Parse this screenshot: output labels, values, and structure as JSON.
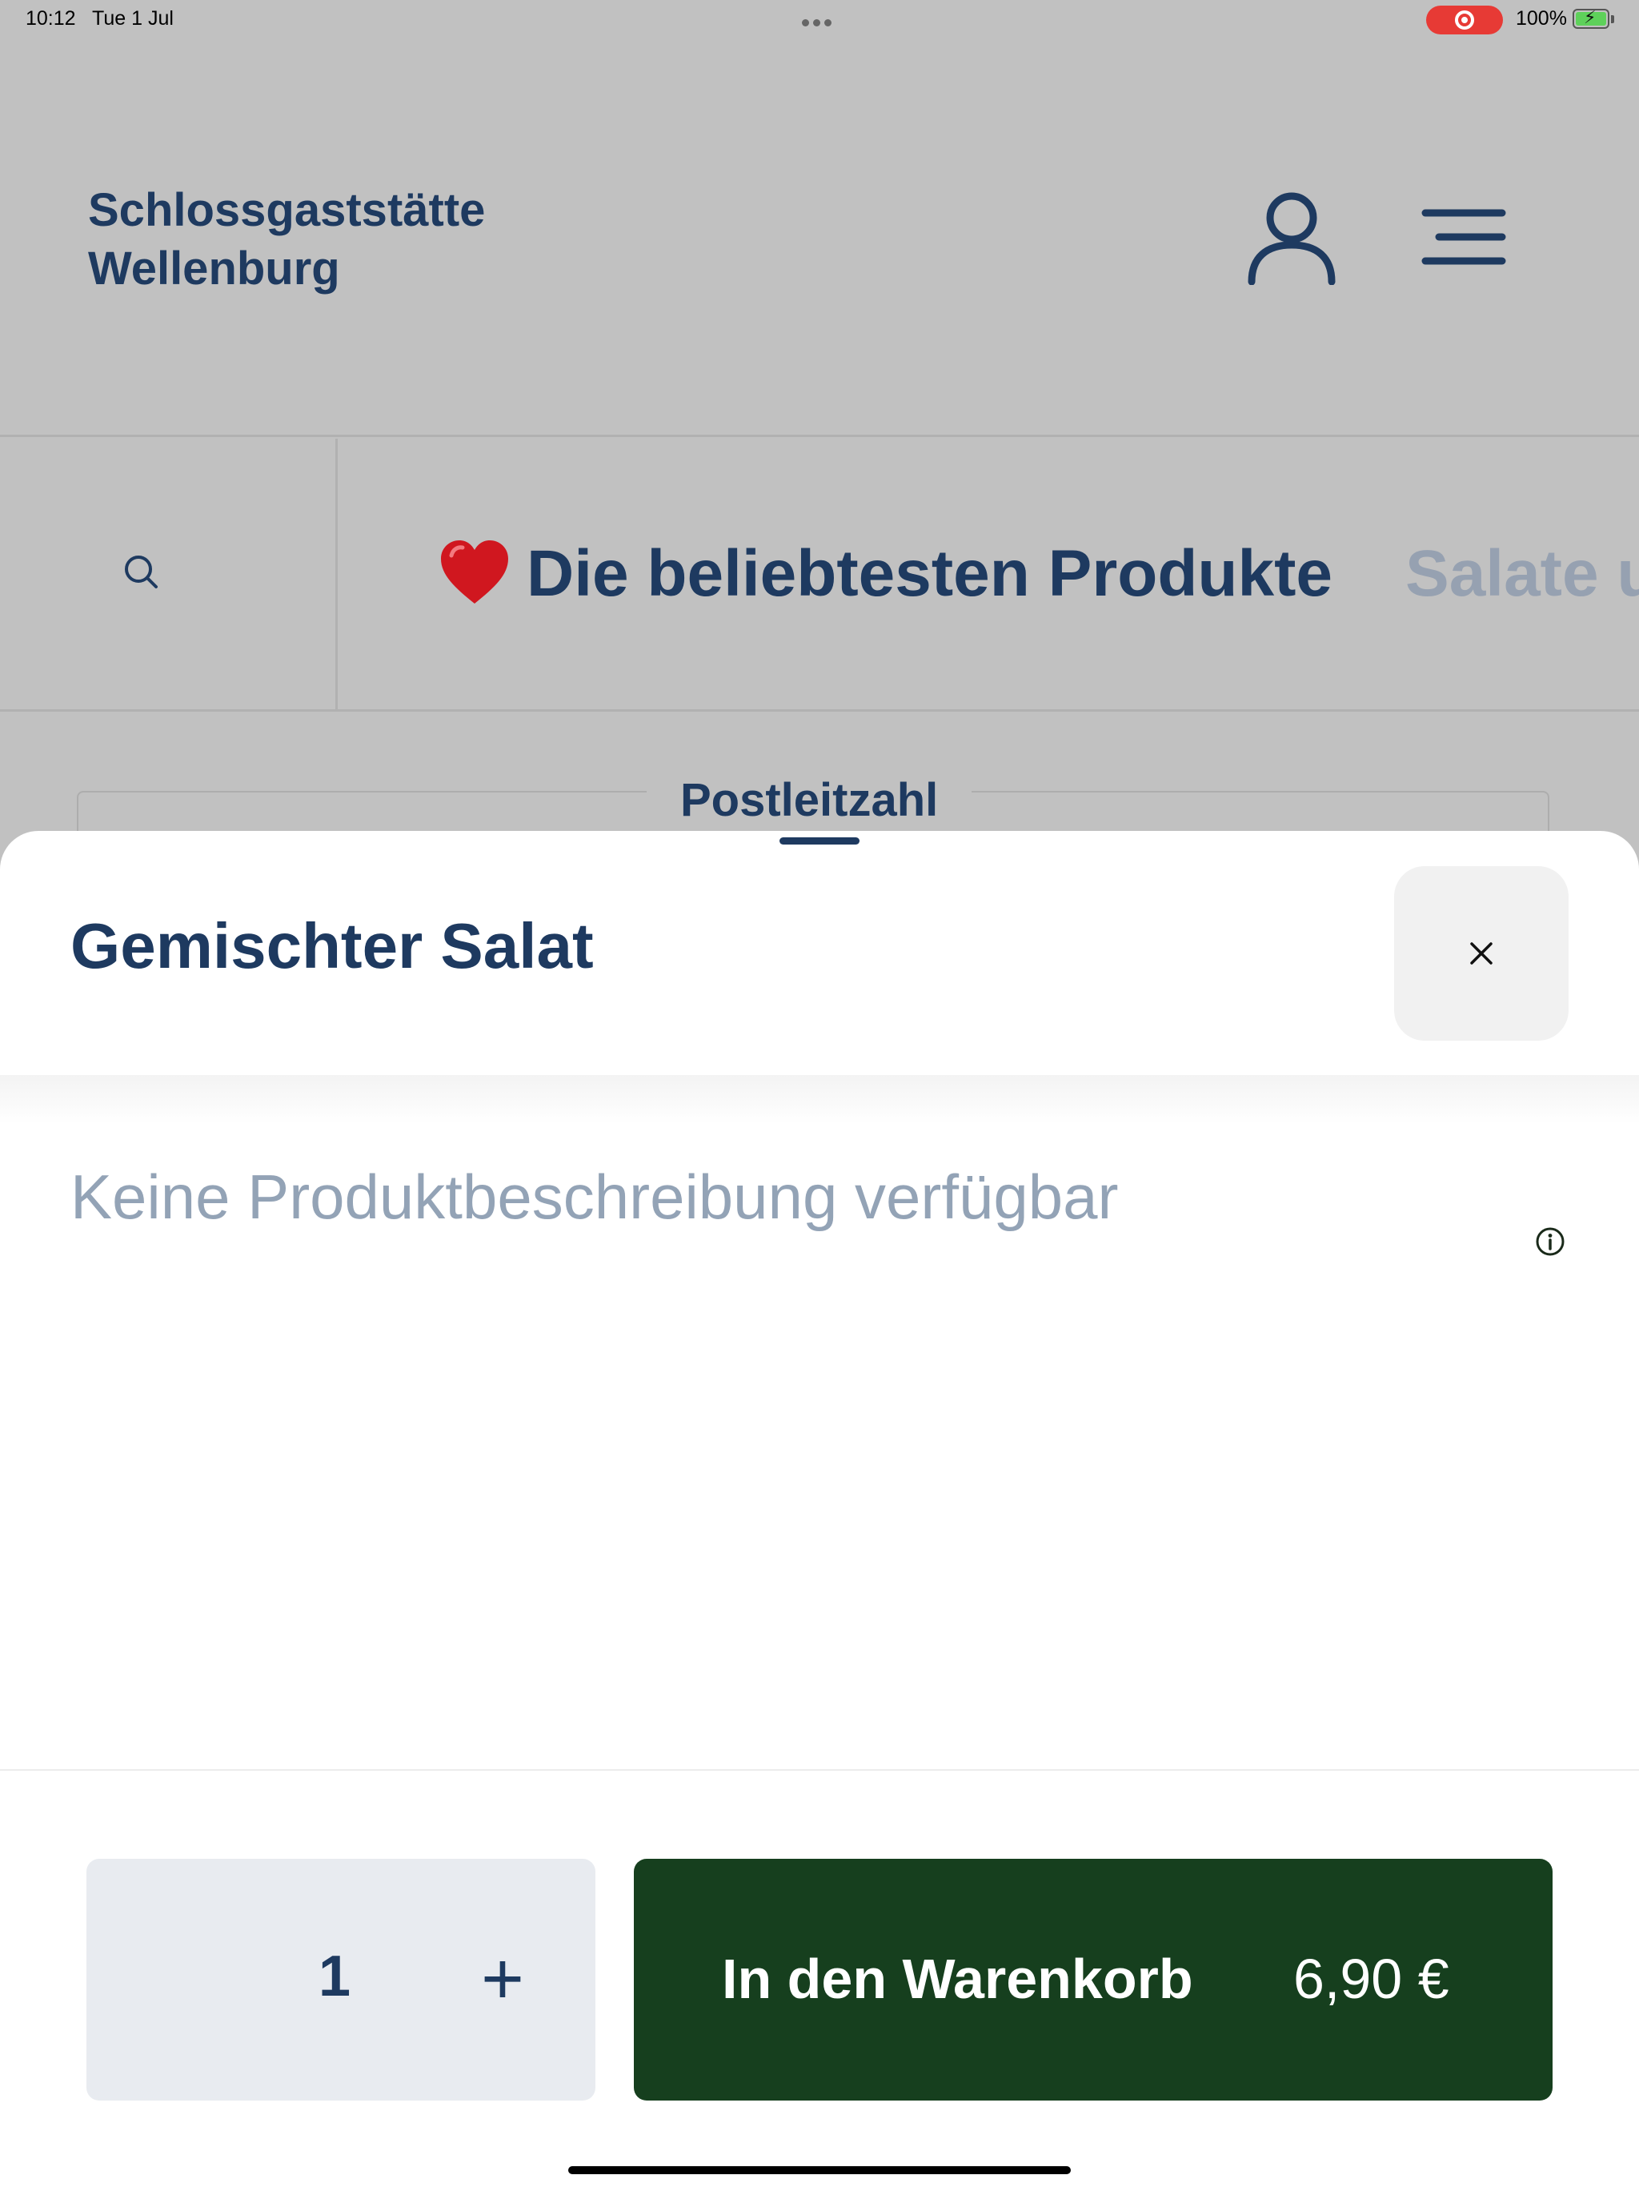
{
  "status_bar": {
    "time": "10:12",
    "date": "Tue 1 Jul",
    "battery_percent": "100%"
  },
  "header": {
    "brand_line1": "Schlossgaststätte",
    "brand_line2": "Wellenburg",
    "icons": [
      "user-icon",
      "menu-icon"
    ]
  },
  "categories": {
    "search_icon": "search-icon",
    "active_icon": "heart-icon",
    "active_label": "Die beliebtesten Produkte",
    "next_label": "Salate u"
  },
  "postcode": {
    "label": "Postleitzahl"
  },
  "product_sheet": {
    "title": "Gemischter Salat",
    "close_icon": "close-icon",
    "description": "Keine Produktbeschreibung verfügbar",
    "info_icon": "info-icon",
    "quantity": "1",
    "increment_label": "+",
    "add_to_cart_label": "In den Warenkorb",
    "price": "6,90 €"
  },
  "colors": {
    "brand_navy": "#1e3a60",
    "cart_green": "#163f1e",
    "overlay_gray": "#c1c1c1",
    "muted_text": "#93a3b6",
    "stepper_bg": "#e8ebf0",
    "record_red": "#e73a35"
  }
}
